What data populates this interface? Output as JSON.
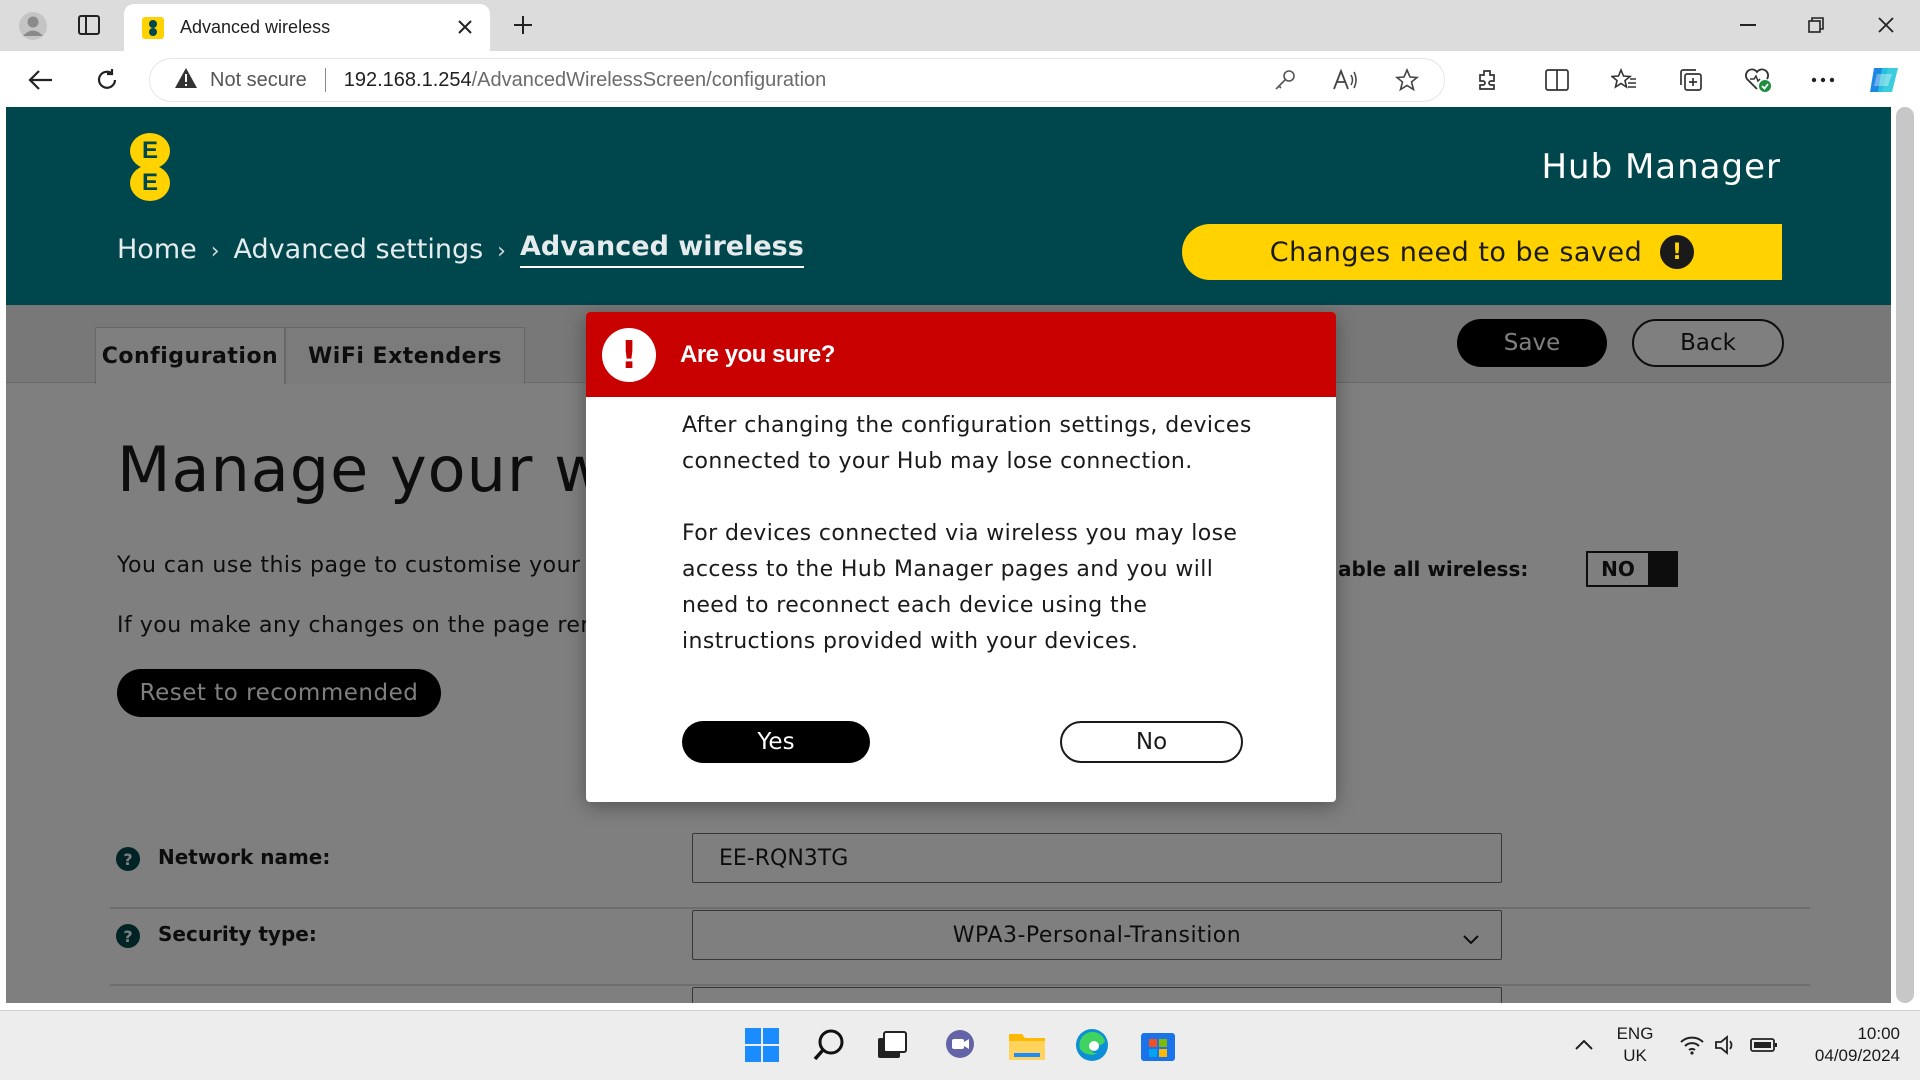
{
  "browser": {
    "tab_title": "Advanced wireless",
    "address": {
      "security_label": "Not secure",
      "url_host": "192.168.1.254",
      "url_path": "/AdvancedWirelessScreen/configuration"
    }
  },
  "header": {
    "logo_letters": [
      "E",
      "E"
    ],
    "app_title": "Hub Manager",
    "breadcrumb": {
      "home": "Home",
      "section": "Advanced settings",
      "current": "Advanced wireless"
    },
    "banner": {
      "text": "Changes need to be saved",
      "icon": "!"
    }
  },
  "tabs": {
    "configuration": "Configuration",
    "wifi_extenders": "WiFi Extenders"
  },
  "actions": {
    "save": "Save",
    "back": "Back"
  },
  "main": {
    "title": "Manage your wir",
    "intro1": "You can use this page to customise your w",
    "intro2": "If you make any changes on the page rem",
    "reset": "Reset to recommended",
    "disable_label": "able all wireless:",
    "disable_toggle": "NO",
    "fields": {
      "network_name_label": "Network name:",
      "network_name_value": "EE-RQN3TG",
      "security_type_label": "Security type:",
      "security_type_value": "WPA3-Personal-Transition"
    }
  },
  "dialog": {
    "title": "Are you sure?",
    "paragraph1": "After changing the configuration settings, devices connected to your Hub may lose connection.",
    "paragraph2": "For devices connected via wireless you may lose access to the Hub Manager pages and you will need to reconnect each device using the instructions provided with your devices.",
    "yes": "Yes",
    "no": "No"
  },
  "taskbar": {
    "lang_top": "ENG",
    "lang_bottom": "UK",
    "time": "10:00",
    "date": "04/09/2024"
  },
  "colors": {
    "header_bg": "#00474d",
    "accent_yellow": "#ffd200",
    "dialog_red": "#c90000"
  }
}
